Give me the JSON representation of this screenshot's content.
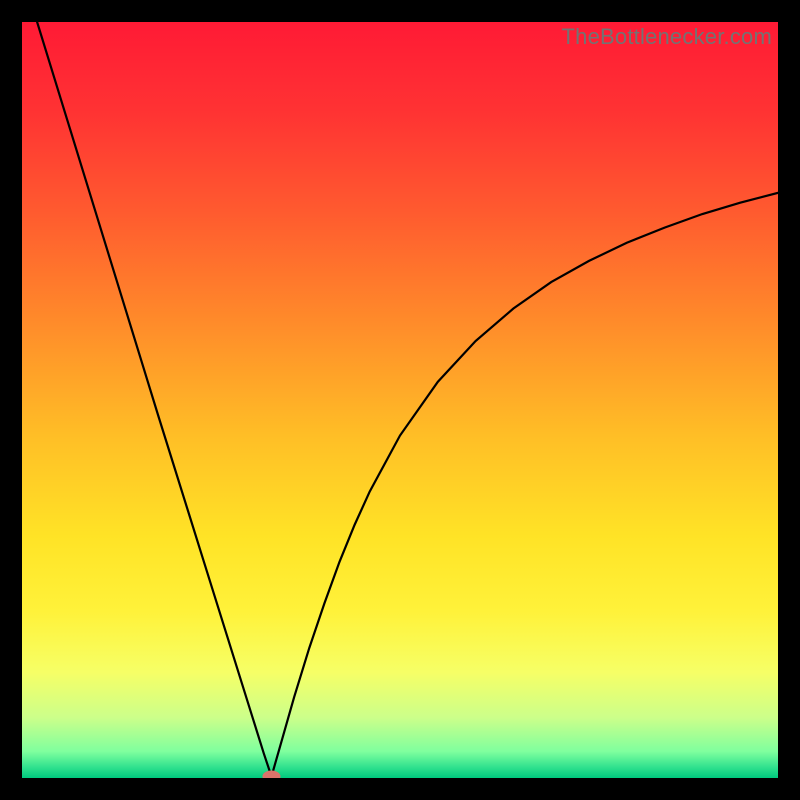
{
  "watermark": "TheBottlenecker.com",
  "colors": {
    "frame": "#000000",
    "curve": "#000000",
    "marker": "#d9736a",
    "watermark": "#737373",
    "gradient_stops": [
      {
        "offset": 0.0,
        "color": "#ff1a35"
      },
      {
        "offset": 0.12,
        "color": "#ff3333"
      },
      {
        "offset": 0.25,
        "color": "#ff5a2f"
      },
      {
        "offset": 0.4,
        "color": "#ff8c2a"
      },
      {
        "offset": 0.55,
        "color": "#ffbf26"
      },
      {
        "offset": 0.68,
        "color": "#ffe326"
      },
      {
        "offset": 0.78,
        "color": "#fff23a"
      },
      {
        "offset": 0.86,
        "color": "#f6ff66"
      },
      {
        "offset": 0.92,
        "color": "#ccff8a"
      },
      {
        "offset": 0.965,
        "color": "#7fff9e"
      },
      {
        "offset": 0.985,
        "color": "#33e28f"
      },
      {
        "offset": 1.0,
        "color": "#00c97e"
      }
    ]
  },
  "chart_data": {
    "type": "line",
    "title": "",
    "xlabel": "",
    "ylabel": "",
    "xlim": [
      0,
      100
    ],
    "ylim": [
      0,
      100
    ],
    "grid": false,
    "legend": false,
    "x": [
      2,
      4,
      6,
      8,
      10,
      12,
      14,
      16,
      18,
      20,
      22,
      24,
      26,
      28,
      30,
      31,
      32,
      33,
      34,
      36,
      38,
      40,
      42,
      44,
      46,
      50,
      55,
      60,
      65,
      70,
      75,
      80,
      85,
      90,
      95,
      100
    ],
    "values": [
      100,
      93.5,
      87,
      80.5,
      74,
      67.5,
      61,
      54.5,
      48,
      41.6,
      35.2,
      28.8,
      22.4,
      16,
      9.6,
      6.4,
      3.2,
      0.2,
      3.7,
      10.7,
      17.2,
      23.1,
      28.6,
      33.5,
      37.9,
      45.3,
      52.4,
      57.8,
      62.1,
      65.6,
      68.4,
      70.8,
      72.8,
      74.6,
      76.1,
      77.4
    ],
    "marker": {
      "x": 33,
      "y": 0.2
    }
  }
}
